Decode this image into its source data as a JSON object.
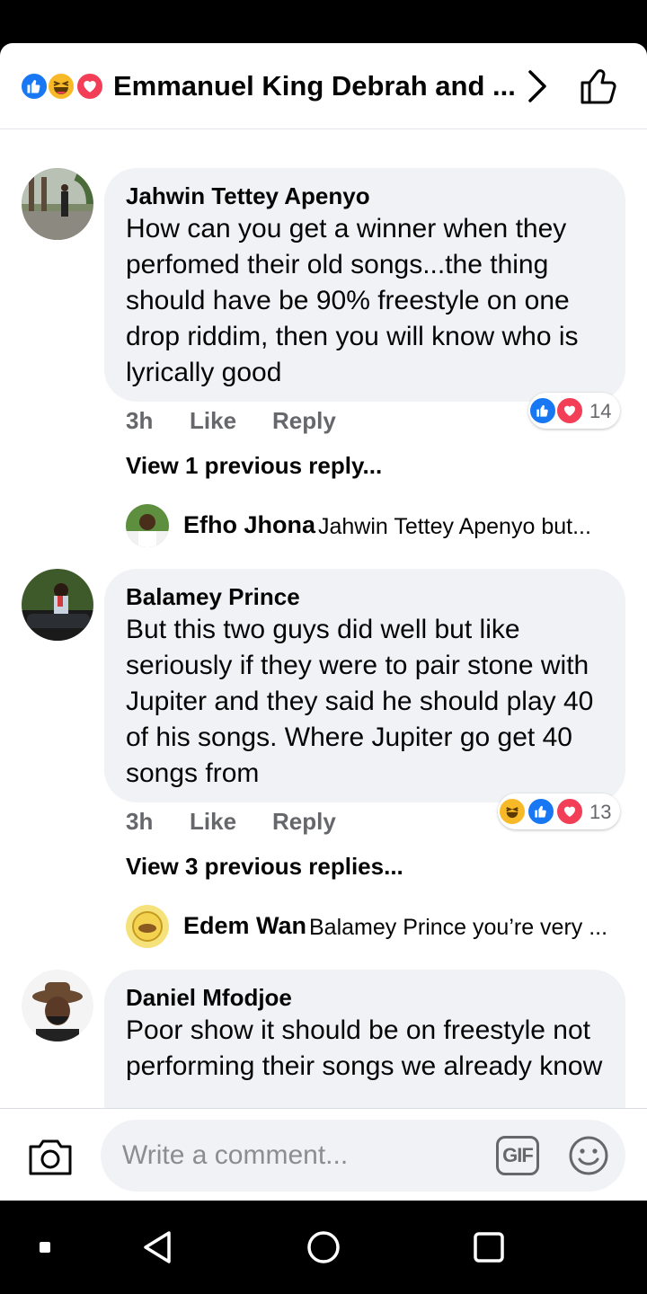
{
  "header": {
    "title": "Emmanuel King Debrah and ...",
    "reactions": [
      "like-icon",
      "haha-icon",
      "love-icon"
    ]
  },
  "comments": [
    {
      "author": "Jahwin Tettey Apenyo",
      "text": "How can you get a winner when they perfomed their old songs...the thing should have be 90% freestyle on one drop riddim, then you will know who is lyrically good",
      "time": "3h",
      "like_label": "Like",
      "reply_label": "Reply",
      "reaction_count": "14",
      "view_replies": "View 1 previous reply...",
      "reply": {
        "author": "Efho Jhona",
        "text": "Jahwin Tettey Apenyo  but..."
      }
    },
    {
      "author": "Balamey Prince",
      "text": "But this two guys did well but like seriously if they were to pair stone with Jupiter and they said he should play 40 of his songs. Where Jupiter go get 40 songs from",
      "time": "3h",
      "like_label": "Like",
      "reply_label": "Reply",
      "reaction_count": "13",
      "view_replies": "View 3 previous replies...",
      "reply": {
        "author": "Edem Wan",
        "text": "Balamey Prince you’re very ..."
      }
    },
    {
      "author": "Daniel Mfodjoe",
      "text": "Poor show it should be on freestyle not performing their songs we already know"
    }
  ],
  "composer": {
    "placeholder": "Write a comment...",
    "gif_label": "GIF"
  },
  "colors": {
    "like": "#1877f2",
    "love": "#f33e58",
    "haha": "#f7b928",
    "bubble": "#f0f2f5",
    "secondary_text": "#65676b"
  }
}
